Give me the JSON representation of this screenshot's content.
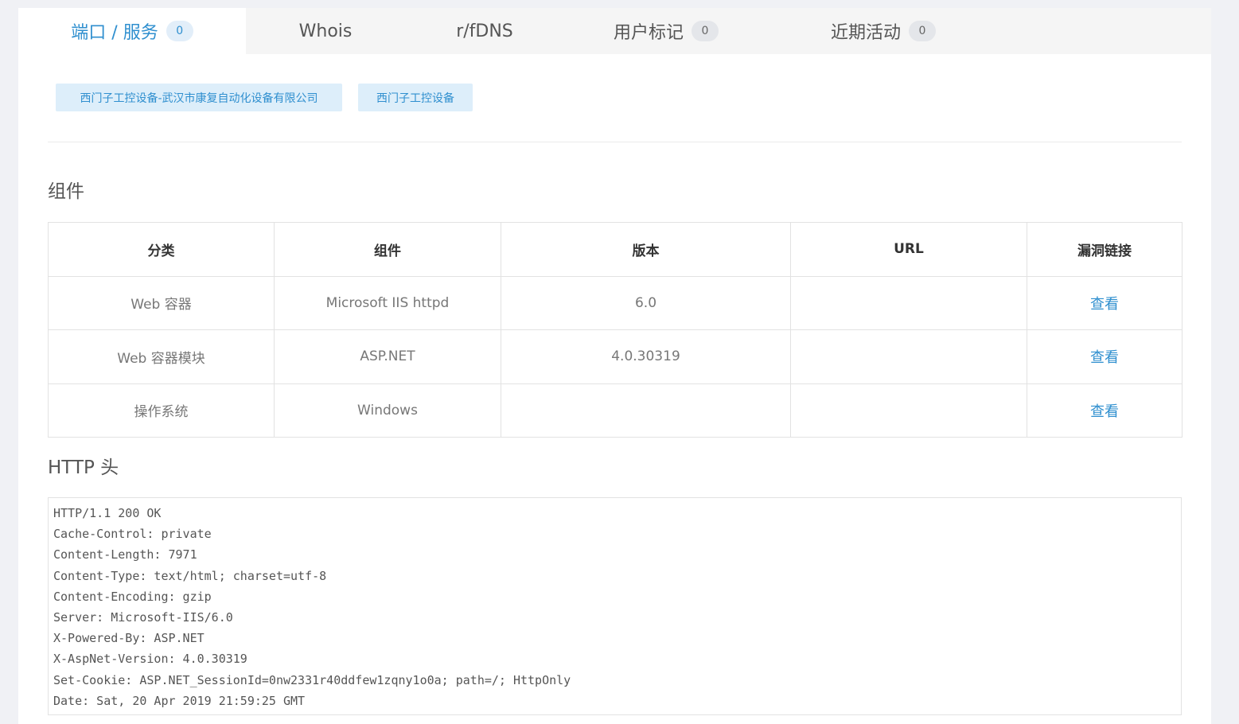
{
  "tabs": [
    {
      "label": "端口 / 服务",
      "count": "0",
      "active": true
    },
    {
      "label": "Whois"
    },
    {
      "label": "r/fDNS"
    },
    {
      "label": "用户标记",
      "count": "0"
    },
    {
      "label": "近期活动",
      "count": "0"
    }
  ],
  "tags": [
    "西门子工控设备-武汉市康复自动化设备有限公司",
    "西门子工控设备"
  ],
  "components_section": {
    "title": "组件",
    "headers": [
      "分类",
      "组件",
      "版本",
      "URL",
      "漏洞链接"
    ],
    "rows": [
      {
        "category": "Web 容器",
        "component": "Microsoft IIS httpd",
        "version": "6.0",
        "url": "",
        "link": "查看"
      },
      {
        "category": "Web 容器模块",
        "component": "ASP.NET",
        "version": "4.0.30319",
        "url": "",
        "link": "查看"
      },
      {
        "category": "操作系统",
        "component": "Windows",
        "version": "",
        "url": "",
        "link": "查看"
      }
    ]
  },
  "http_section": {
    "title": "HTTP 头",
    "lines": [
      "HTTP/1.1 200 OK",
      "Cache-Control: private",
      "Content-Length: 7971",
      "Content-Type: text/html; charset=utf-8",
      "Content-Encoding: gzip",
      "Server: Microsoft-IIS/6.0",
      "X-Powered-By: ASP.NET",
      "X-AspNet-Version: 4.0.30319",
      "Set-Cookie: ASP.NET_SessionId=0nw2331r40ddfew1zqny1o0a; path=/; HttpOnly",
      "Date: Sat, 20 Apr 2019 21:59:25 GMT"
    ]
  },
  "colors": {
    "accent": "#2f8fcf",
    "tag_bg": "#ddeefa",
    "page_bg": "#f0f1f5",
    "tabbar_bg": "#f5f5f5"
  }
}
